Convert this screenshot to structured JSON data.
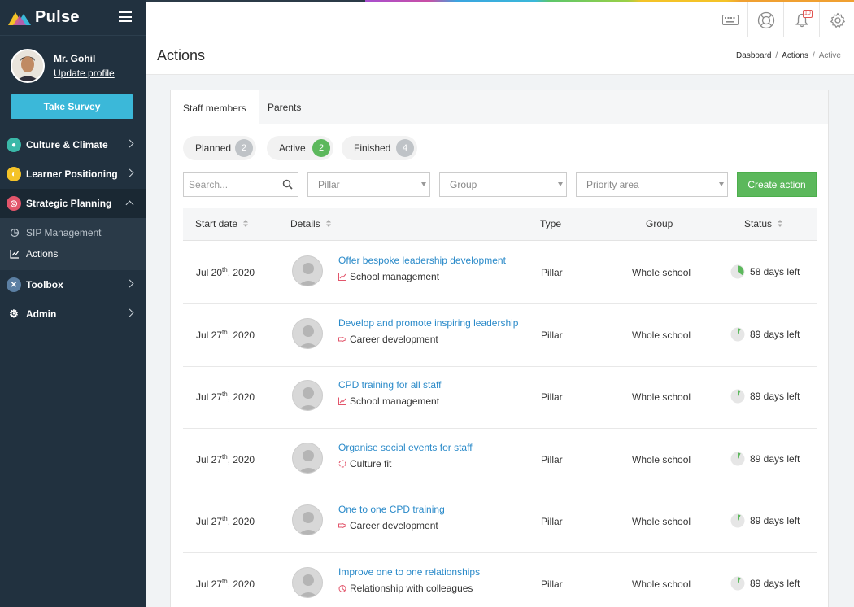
{
  "app": {
    "name": "Pulse"
  },
  "user": {
    "name": "Mr. Gohil",
    "update_profile": "Update profile"
  },
  "survey_button": "Take Survey",
  "nav": {
    "culture": "Culture & Climate",
    "learner": "Learner Positioning",
    "strategic": "Strategic Planning",
    "sip": "SIP Management",
    "actions": "Actions",
    "toolbox": "Toolbox",
    "admin": "Admin"
  },
  "topbar": {
    "notifications": "10"
  },
  "page": {
    "title": "Actions"
  },
  "breadcrumb": {
    "home": "Dasboard",
    "actions": "Actions",
    "current": "Active"
  },
  "tabs": {
    "staff": "Staff members",
    "parents": "Parents"
  },
  "status_filters": {
    "planned": {
      "label": "Planned",
      "count": "2"
    },
    "active": {
      "label": "Active",
      "count": "2"
    },
    "finished": {
      "label": "Finished",
      "count": "4"
    }
  },
  "filters": {
    "search_placeholder": "Search...",
    "pillar": "Pillar",
    "group": "Group",
    "priority": "Priority area",
    "create": "Create action"
  },
  "table": {
    "headers": {
      "start": "Start date",
      "details": "Details",
      "type": "Type",
      "group": "Group",
      "status": "Status"
    },
    "rows": [
      {
        "date": "Jul 20",
        "suffix": "th",
        "year": ", 2020",
        "title": "Offer bespoke leadership development",
        "category": "School management",
        "type": "Pillar",
        "group": "Whole school",
        "status": "58 days left",
        "progress": 0.35
      },
      {
        "date": "Jul 27",
        "suffix": "th",
        "year": ", 2020",
        "title": "Develop and promote inspiring leadership",
        "category": "Career development",
        "type": "Pillar",
        "group": "Whole school",
        "status": "89 days left",
        "progress": 0.08
      },
      {
        "date": "Jul 27",
        "suffix": "th",
        "year": ", 2020",
        "title": "CPD training for all staff",
        "category": "School management",
        "type": "Pillar",
        "group": "Whole school",
        "status": "89 days left",
        "progress": 0.08
      },
      {
        "date": "Jul 27",
        "suffix": "th",
        "year": ", 2020",
        "title": "Organise social events for staff",
        "category": "Culture fit",
        "type": "Pillar",
        "group": "Whole school",
        "status": "89 days left",
        "progress": 0.08
      },
      {
        "date": "Jul 27",
        "suffix": "th",
        "year": ", 2020",
        "title": "One to one CPD training",
        "category": "Career development",
        "type": "Pillar",
        "group": "Whole school",
        "status": "89 days left",
        "progress": 0.08
      },
      {
        "date": "Jul 27",
        "suffix": "th",
        "year": ", 2020",
        "title": "Improve one to one relationships",
        "category": "Relationship with colleagues",
        "type": "Pillar",
        "group": "Whole school",
        "status": "89 days left",
        "progress": 0.08
      }
    ]
  },
  "colors": {
    "sidebar": "#21313f",
    "accent": "#5cb85c",
    "link": "#2a8ac9"
  }
}
